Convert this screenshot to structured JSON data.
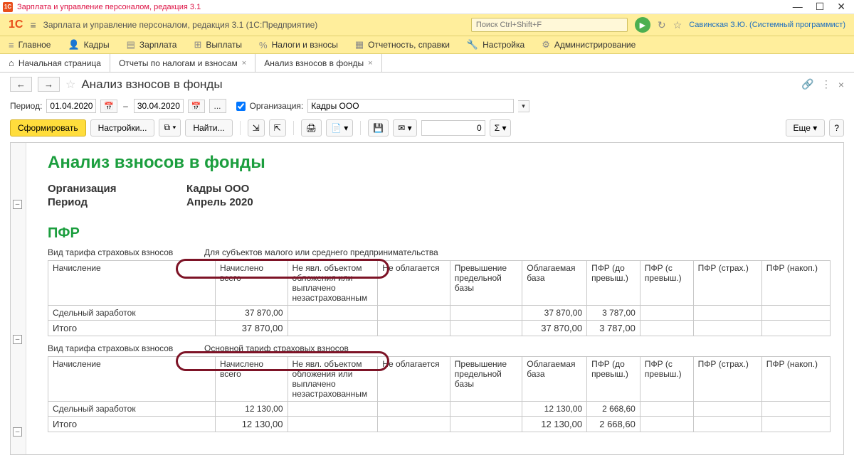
{
  "window": {
    "title": "Зарплата и управление персоналом, редакция 3.1"
  },
  "header": {
    "logo": "1С",
    "app_title": "Зарплата и управление персоналом, редакция 3.1  (1С:Предприятие)",
    "search_placeholder": "Поиск Ctrl+Shift+F",
    "user": "Савинская З.Ю. (Системный программист)"
  },
  "menu": {
    "items": [
      {
        "icon": "≡",
        "label": "Главное"
      },
      {
        "icon": "👤",
        "label": "Кадры"
      },
      {
        "icon": "📄",
        "label": "Зарплата"
      },
      {
        "icon": "💰",
        "label": "Выплаты"
      },
      {
        "icon": "%",
        "label": "Налоги и взносы"
      },
      {
        "icon": "📋",
        "label": "Отчетность, справки"
      },
      {
        "icon": "🔧",
        "label": "Настройка"
      },
      {
        "icon": "⚙",
        "label": "Администрирование"
      }
    ]
  },
  "tabs": [
    {
      "label": "Начальная страница",
      "home": true,
      "closable": false
    },
    {
      "label": "Отчеты по налогам и взносам",
      "closable": true
    },
    {
      "label": "Анализ взносов в фонды",
      "closable": true,
      "active": true
    }
  ],
  "page": {
    "title": "Анализ взносов в фонды"
  },
  "filter": {
    "period_label": "Период:",
    "date_from": "01.04.2020",
    "date_to": "30.04.2020",
    "org_label": "Организация:",
    "org_value": "Кадры ООО"
  },
  "toolbar": {
    "form": "Сформировать",
    "settings": "Настройки...",
    "find": "Найти...",
    "more": "Еще",
    "num_value": "0"
  },
  "report": {
    "title": "Анализ взносов в фонды",
    "org_label": "Организация",
    "org_value": "Кадры ООО",
    "period_label": "Период",
    "period_value": "Апрель 2020",
    "section": "ПФР",
    "tariff_label": "Вид тарифа страховых взносов",
    "tariff1": "Для субъектов малого или среднего предпринимательства",
    "tariff2": "Основной тариф страховых взносов",
    "columns": [
      "Начисление",
      "Начислено всего",
      "Не явл. объектом обложения или выплачено незастрахованным",
      "Не облагается",
      "Превышение предельной базы",
      "Облагаемая база",
      "ПФР (до превыш.)",
      "ПФР (с превыш.)",
      "ПФР (страх.)",
      "ПФР (накоп.)"
    ],
    "row1_name": "Сдельный заработок",
    "total_label": "Итого",
    "block1": {
      "accrued": "37 870,00",
      "base": "37 870,00",
      "pfr_pre": "3 787,00",
      "total_accrued": "37 870,00",
      "total_base": "37 870,00",
      "total_pfr_pre": "3 787,00"
    },
    "block2": {
      "accrued": "12 130,00",
      "base": "12 130,00",
      "pfr_pre": "2 668,60",
      "total_accrued": "12 130,00",
      "total_base": "12 130,00",
      "total_pfr_pre": "2 668,60"
    }
  }
}
